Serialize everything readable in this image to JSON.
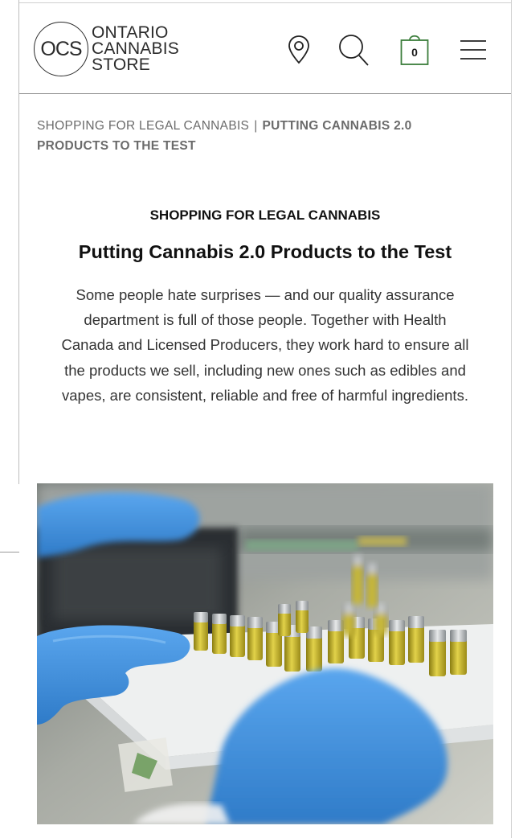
{
  "header": {
    "logo": {
      "mark": "OCS",
      "lines": [
        "ONTARIO",
        "CANNABIS",
        "STORE"
      ]
    },
    "icons": [
      "location-icon",
      "search-icon",
      "cart-icon",
      "menu-icon"
    ],
    "cart_count": "0"
  },
  "breadcrumb": {
    "parent": "SHOPPING FOR LEGAL CANNABIS",
    "separator": "|",
    "current": "PUTTING CANNABIS 2.0 PRODUCTS TO THE TEST"
  },
  "article": {
    "category": "SHOPPING FOR LEGAL CANNABIS",
    "title": "Putting Cannabis 2.0 Products to the Test",
    "intro": "Some people hate surprises — and our quality assurance department is full of those people. Together with Health Canada and Licensed Producers, they work hard to ensure all the products we sell, including new ones such as edibles and vapes, are consistent, reliable and free of harmful ingredients."
  },
  "colors": {
    "cart_green": "#3b7d3b",
    "text_dark": "#111111",
    "text_muted": "#6b6b6b",
    "glove_blue": "#3f8fd9",
    "vial_oil": "#c9b52a"
  }
}
